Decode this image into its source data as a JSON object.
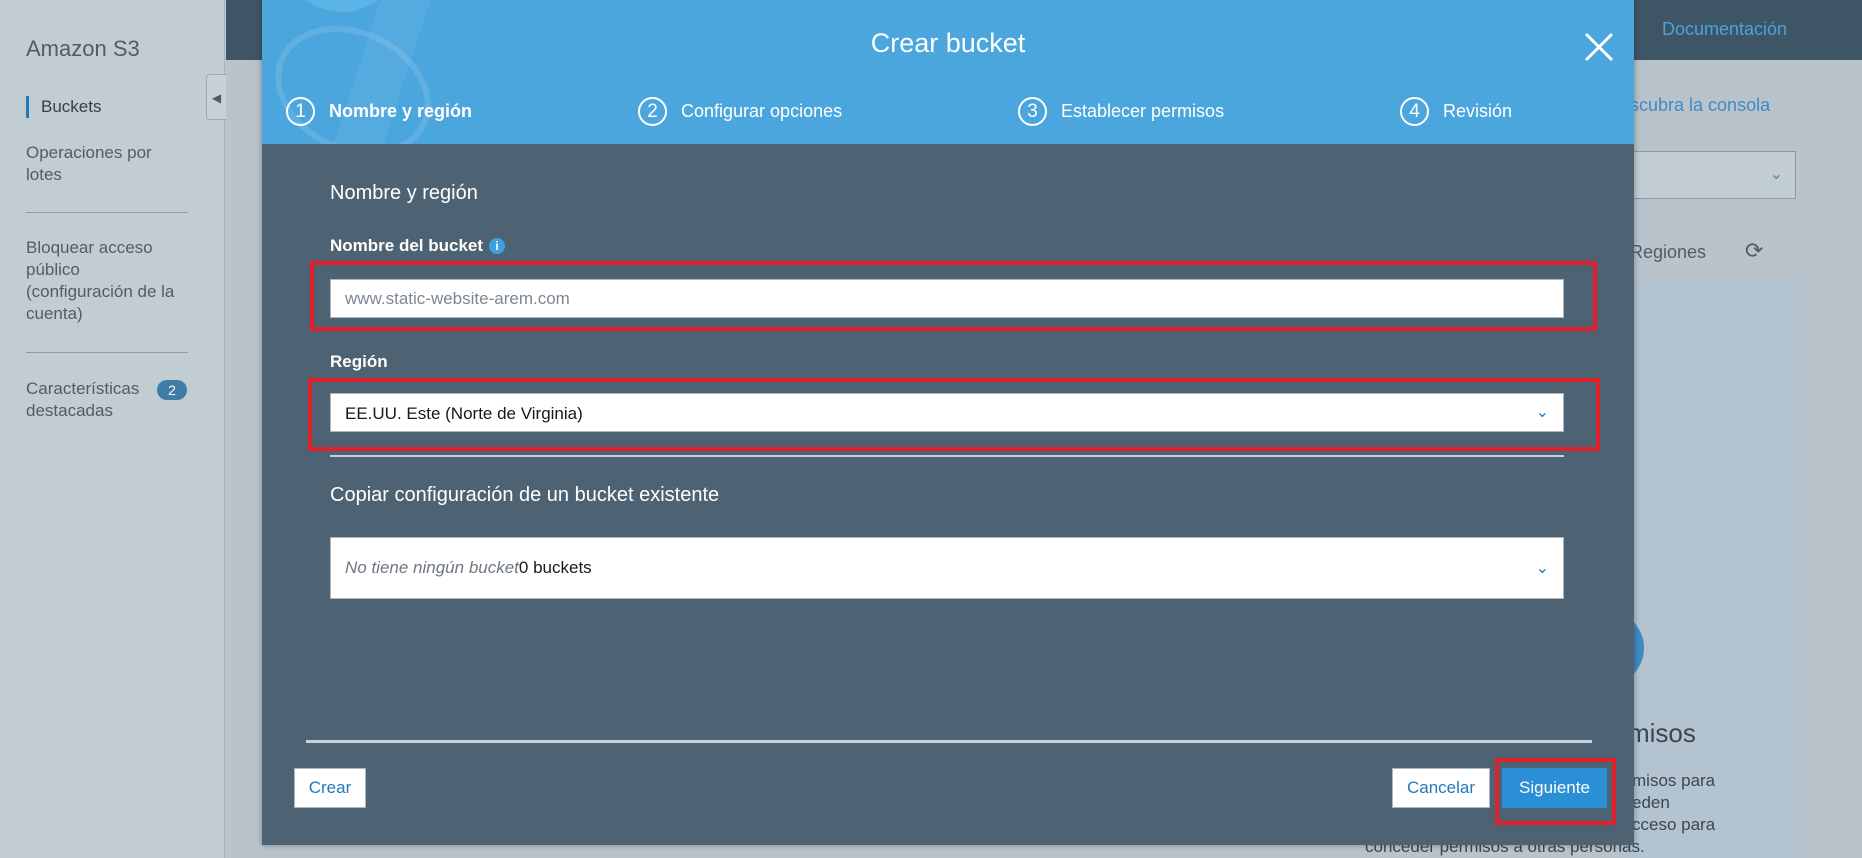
{
  "sidebar": {
    "title": "Amazon S3",
    "items": [
      {
        "label": "Buckets"
      },
      {
        "label": "Operaciones por lotes"
      },
      {
        "label": "Bloquear acceso público (configuración de la cuenta)"
      },
      {
        "label": "Características destacadas",
        "badge": "2"
      }
    ]
  },
  "background": {
    "doc_link": "Documentación",
    "console_link": "escubra la consola",
    "regions_label": "Regiones",
    "perms_heading": "misos",
    "perms_text": [
      "misos para",
      "eden",
      "cceso para",
      "conceder permisos a otras personas."
    ]
  },
  "modal": {
    "title": "Crear bucket",
    "steps": [
      {
        "num": "1",
        "label": "Nombre y región",
        "active": true
      },
      {
        "num": "2",
        "label": "Configurar opciones"
      },
      {
        "num": "3",
        "label": "Establecer permisos"
      },
      {
        "num": "4",
        "label": "Revisión"
      }
    ],
    "section_title": "Nombre y región",
    "bucket_name": {
      "label": "Nombre del bucket",
      "value": "",
      "placeholder": "www.static-website-arem.com"
    },
    "region": {
      "label": "Región",
      "selected": "EE.UU. Este (Norte de Virginia)"
    },
    "copy_config": {
      "title": "Copiar configuración de un bucket existente",
      "placeholder": "No tiene ningún bucket",
      "count": "0 buckets"
    },
    "buttons": {
      "create": "Crear",
      "cancel": "Cancelar",
      "next": "Siguiente"
    }
  },
  "colors": {
    "header_blue": "#4ba6dd",
    "modal_body": "#4d6373",
    "highlight_red": "#e0212b",
    "primary_button": "#2b8fd6"
  }
}
